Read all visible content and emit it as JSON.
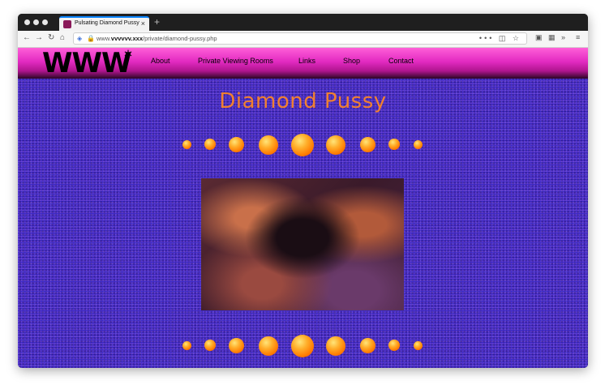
{
  "browser": {
    "tab_title": "Pulsating Diamond Pussy",
    "tab_close": "×",
    "new_tab": "+",
    "url_prefix": "www.",
    "url_domain": "vvvvvv.xxx",
    "url_path": "/private/diamond-pussy.php",
    "icons": {
      "back": "←",
      "forward": "→",
      "reload": "↻",
      "home": "⌂",
      "shield": "◈",
      "lock": "🔒",
      "more": "•••",
      "pocket": "◫",
      "bookmark": "☆",
      "sync": "▣",
      "extension": "▦",
      "overflow": "»",
      "menu": "≡"
    }
  },
  "site": {
    "logo": "WWW",
    "logo_star": "*",
    "nav": [
      "About",
      "Private Viewing Rooms",
      "Links",
      "Shop",
      "Contact"
    ],
    "title": "Diamond Pussy",
    "colors": {
      "header": "#e22ac1",
      "background": "#3b2bc7",
      "title": "#f08030",
      "orb": "#ff9a1a"
    }
  }
}
